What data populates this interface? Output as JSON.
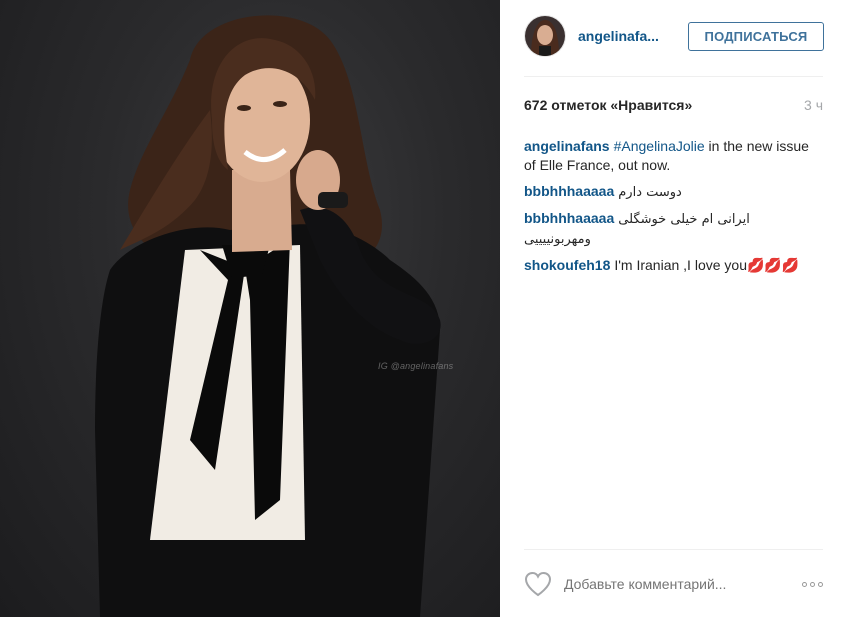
{
  "post": {
    "username": "angelinafa...",
    "follow_label": "ПОДПИСАТЬСЯ",
    "likes": "672 отметок «Нравится»",
    "timestamp": "3 ч",
    "photo_watermark": "IG @angelinafans"
  },
  "comments": [
    {
      "author": "angelinafans",
      "hashtag": "#AngelinaJolie",
      "text": " in the new issue of Elle France, out now."
    },
    {
      "author": "bbbhhhaaaaa",
      "text": "دوست دارم"
    },
    {
      "author": "bbbhhhaaaaa",
      "text": "ایرانی ام خیلی خوشگلی ومهربونییییی"
    },
    {
      "author": "shokoufeh18",
      "text": "I'm Iranian ,I love you💋💋💋"
    }
  ],
  "footer": {
    "comment_placeholder": "Добавьте комментарий...",
    "like_icon": "heart-outline-icon",
    "more_icon": "more-options-icon"
  },
  "colors": {
    "link_blue": "#125688",
    "button_blue": "#3f729b",
    "muted": "#a5a7aa",
    "text": "#262626"
  }
}
